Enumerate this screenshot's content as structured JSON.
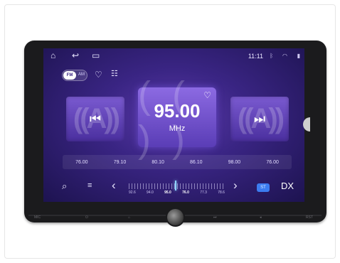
{
  "status_bar": {
    "time": "11:11",
    "home_icon": "home-icon",
    "back_icon": "back-icon",
    "recents_icon": "recents-icon",
    "bluetooth_icon": "bluetooth-icon",
    "wifi_icon": "wifi-icon",
    "battery_icon": "battery-icon"
  },
  "toolbar": {
    "band_toggle_label": "FM",
    "band_toggle_alt": "AM",
    "favorite_icon": "heart-icon",
    "equalizer_icon": "equalizer-icon"
  },
  "tuner": {
    "frequency": "95.00",
    "unit": "MHz",
    "prev_icon": "skip-previous-icon",
    "next_icon": "skip-next-icon"
  },
  "presets": [
    "76.00",
    "79.10",
    "80.10",
    "86.10",
    "98.00",
    "76.00"
  ],
  "bottom_bar": {
    "search_icon": "search-icon",
    "list_icon": "list-icon",
    "left_arrow": "chevron-left-icon",
    "right_arrow": "chevron-right-icon",
    "scale_labels": [
      "92.6",
      "94.0",
      "95.0",
      "76.0",
      "77.3",
      "78.6"
    ],
    "scale_highlight_index": 2,
    "stereo_button": "ST",
    "dx_label": "DX"
  },
  "colors": {
    "accent": "#3c7cf0",
    "screen_bg": "#3a2584",
    "card": "#7a5ad0"
  }
}
